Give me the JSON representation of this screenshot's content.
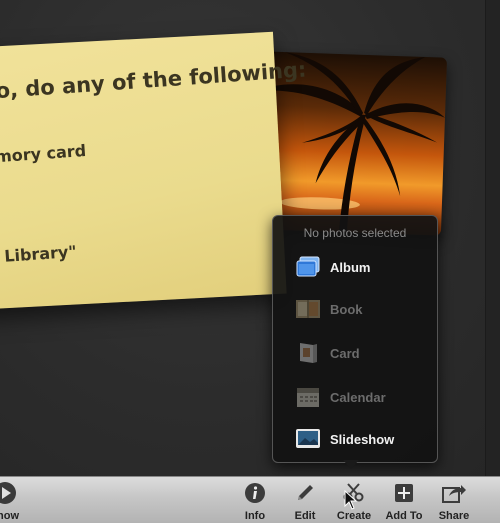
{
  "note": {
    "line1": "o, do any of the following:",
    "line2": "mory card",
    "line3": "Library\""
  },
  "create_popover": {
    "header": "No photos selected",
    "items": [
      {
        "label": "Album",
        "icon": "album-icon",
        "enabled": true
      },
      {
        "label": "Book",
        "icon": "book-icon",
        "enabled": false
      },
      {
        "label": "Card",
        "icon": "card-icon",
        "enabled": false
      },
      {
        "label": "Calendar",
        "icon": "calendar-icon",
        "enabled": false
      },
      {
        "label": "Slideshow",
        "icon": "slideshow-icon",
        "enabled": true
      }
    ]
  },
  "toolbar": {
    "slideshow_label": "show",
    "info_label": "Info",
    "edit_label": "Edit",
    "create_label": "Create",
    "add_to_label": "Add To",
    "share_label": "Share"
  }
}
